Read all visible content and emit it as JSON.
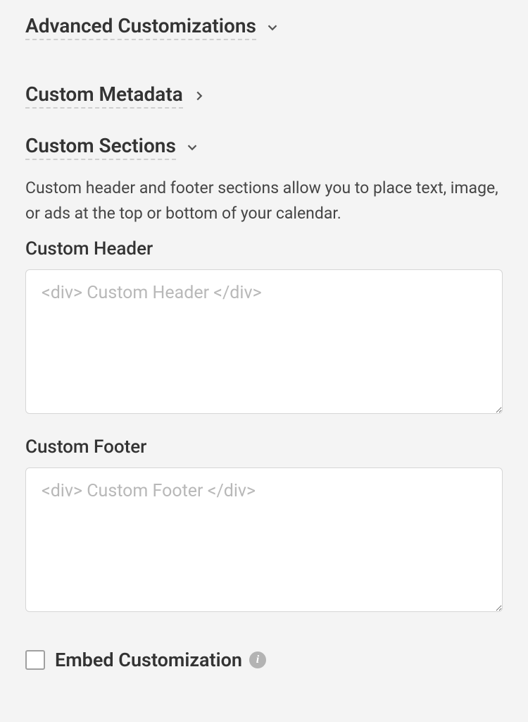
{
  "sections": {
    "advanced": "Advanced Customizations",
    "metadata": "Custom Metadata",
    "customSections": "Custom Sections"
  },
  "customSections": {
    "description": "Custom header and footer sections allow you to place text, image, or ads at the top or bottom of your calendar.",
    "headerLabel": "Custom Header",
    "headerPlaceholder": "<div> Custom Header </div>",
    "footerLabel": "Custom Footer",
    "footerPlaceholder": "<div> Custom Footer </div>"
  },
  "embed": {
    "label": "Embed Customization"
  }
}
